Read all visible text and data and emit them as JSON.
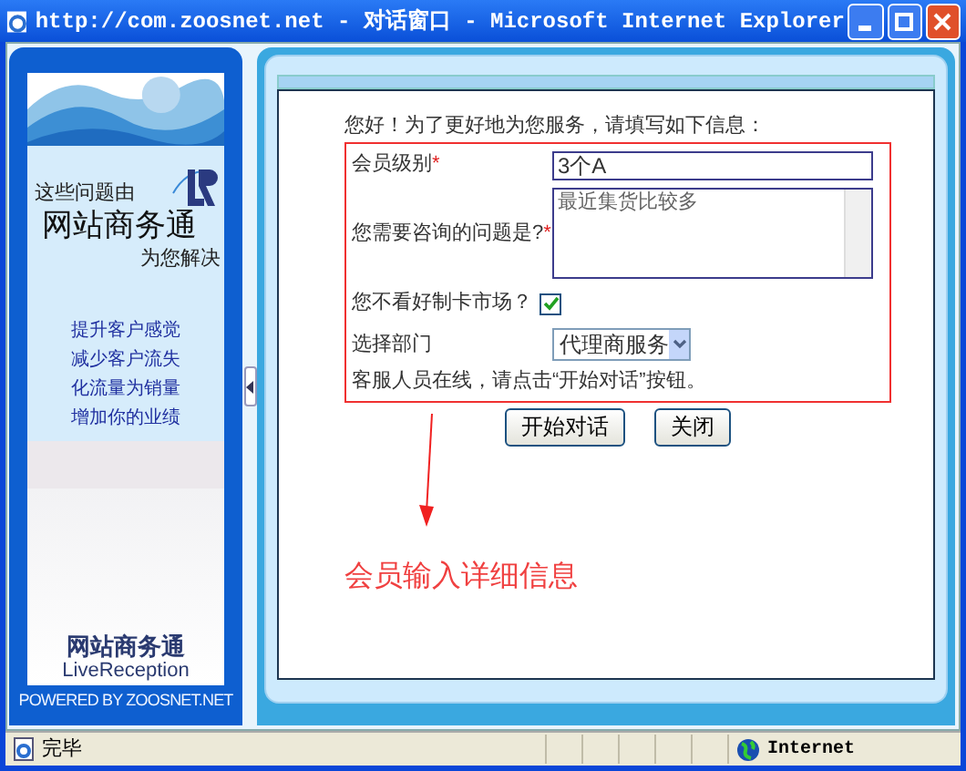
{
  "window": {
    "title": "http://com.zoosnet.net - 对话窗口 - Microsoft Internet Explorer"
  },
  "sidebar": {
    "intro": "这些问题由",
    "brand": "网站商务通",
    "tagline": "为您解决",
    "links": [
      "提升客户感觉",
      "减少客户流失",
      "化流量为销量",
      "增加你的业绩"
    ],
    "footer_brand": "网站商务通",
    "footer_sub": "LiveReception",
    "powered": "POWERED BY ZOOSNET.NET"
  },
  "form": {
    "greeting": "您好！为了更好地为您服务，请填写如下信息：",
    "fields": [
      {
        "kind": "text",
        "label": "会员级别",
        "mark": "*",
        "value": "3个A"
      },
      {
        "kind": "textarea",
        "label": "您需要咨询的问题是?",
        "mark": "*",
        "value": "最近集货比较多"
      },
      {
        "kind": "checkbox",
        "label": "您不看好制卡市场？",
        "checked": true
      },
      {
        "kind": "select",
        "label": "选择部门",
        "value": "代理商服务"
      }
    ],
    "notice": "客服人员在线，请点击“开始对话”按钮。"
  },
  "buttons": [
    "开始对话",
    "关闭"
  ],
  "annotation": "会员输入详细信息",
  "status_bar": {
    "text": "完毕",
    "zone": "Internet"
  }
}
